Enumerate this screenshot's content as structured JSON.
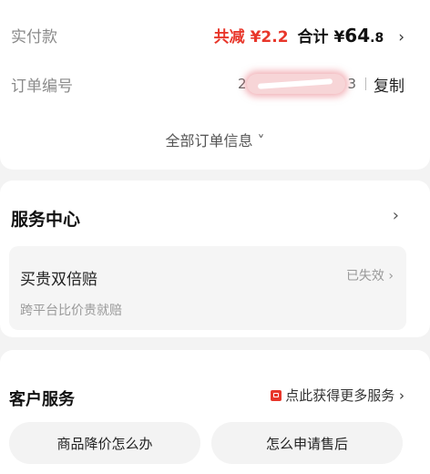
{
  "payment": {
    "label": "实付款",
    "discount": "共减 ¥2.2",
    "total_prefix": "合计 ¥",
    "total_int": "64",
    "total_dec": ".8",
    "chevron": "›"
  },
  "order": {
    "label": "订单编号",
    "number_first_digit": "2",
    "number_last_digit": "3",
    "copy_label": "复制"
  },
  "all_info_label": "全部订单信息 ˅",
  "service_center": {
    "title": "服务中心",
    "chevron": "›",
    "item": {
      "title": "买贵双倍赔",
      "status": "已失效 ›",
      "desc": "跨平台比价贵就赔"
    }
  },
  "customer_service": {
    "title": "客户服务",
    "link": "点此获得更多服务 ›",
    "buttons": [
      "商品降价怎么办",
      "怎么申请售后"
    ]
  },
  "colors": {
    "accent": "#e8362a",
    "background": "#f3f3f3"
  }
}
